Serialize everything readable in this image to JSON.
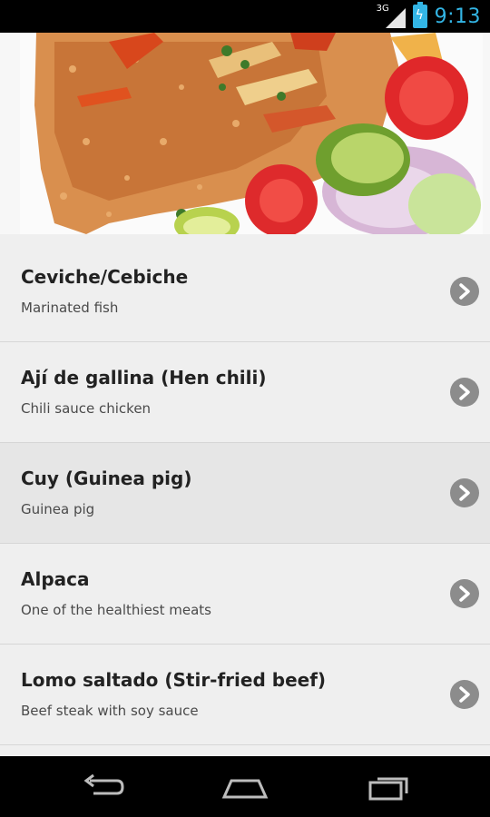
{
  "status_bar": {
    "network": "3G",
    "time": "9:13",
    "accent_color": "#33b5e5"
  },
  "hero": {
    "image": "peruvian-dish-photo"
  },
  "dishes": [
    {
      "title": "Ceviche/Cebiche",
      "subtitle": "Marinated fish"
    },
    {
      "title": "Ají de gallina (Hen chili)",
      "subtitle": "Chili sauce chicken"
    },
    {
      "title": "Cuy (Guinea pig)",
      "subtitle": "Guinea pig"
    },
    {
      "title": "Alpaca",
      "subtitle": "One of the healthiest meats"
    },
    {
      "title": "Lomo saltado (Stir-fried beef)",
      "subtitle": "Beef steak with soy sauce"
    }
  ],
  "nav": {
    "icons": [
      "back-icon",
      "home-icon",
      "recent-apps-icon"
    ]
  }
}
